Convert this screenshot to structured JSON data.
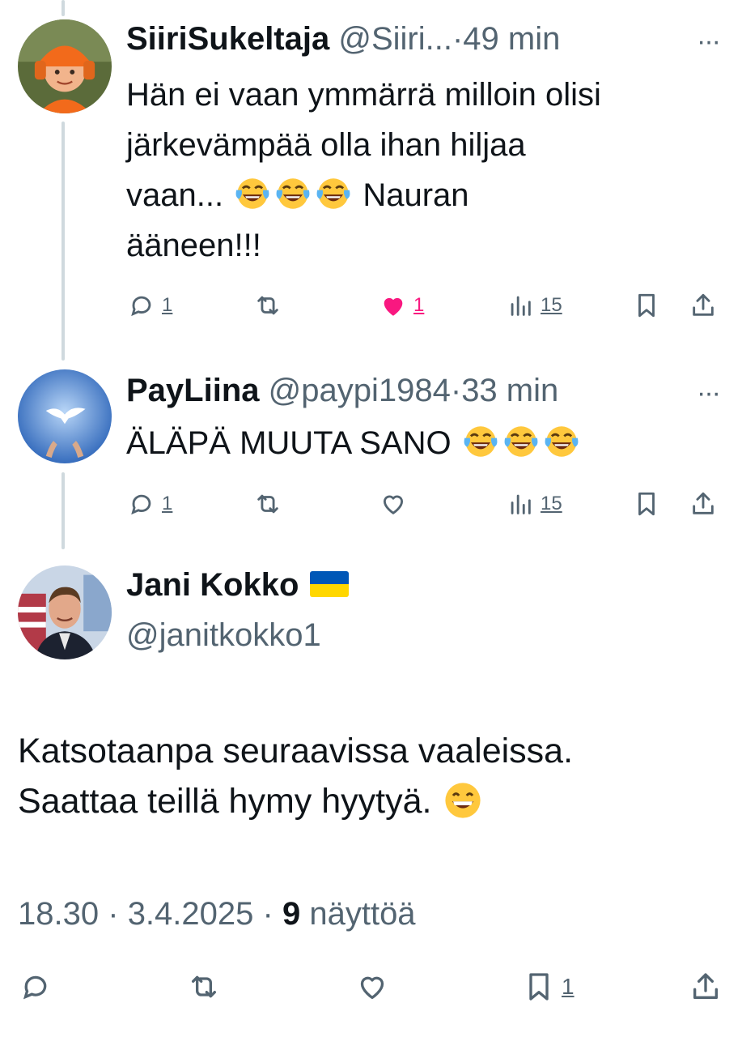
{
  "colors": {
    "text": "#0f1419",
    "secondary": "#536471",
    "like": "#f91880",
    "thread": "#cfd9de"
  },
  "replies": [
    {
      "display_name": "SiiriSukeltaja",
      "handle": "@Siiri...",
      "separator": "·",
      "time": "49 min",
      "more": "···",
      "text_lines": [
        "Hän ei vaan ymmärrä milloin olisi",
        "järkevämpää olla ihan hiljaa",
        "vaan...",
        "Nauran",
        "ääneen!!!"
      ],
      "emoji": "face-with-tears-of-joy",
      "replies_count": "1",
      "likes_count": "1",
      "liked": true,
      "views_count": "15"
    },
    {
      "display_name": "PayLiina",
      "handle": "@paypi1984",
      "separator": "·",
      "time": "33 min",
      "more": "···",
      "text": "ÄLÄPÄ MUUTA SANO",
      "emoji": "face-with-tears-of-joy",
      "replies_count": "1",
      "liked": false,
      "views_count": "15"
    }
  ],
  "main_tweet": {
    "display_name": "Jani Kokko",
    "flag": "ukraine-flag",
    "handle": "@janitkokko1",
    "text_line1": "Katsotaanpa seuraavissa vaaleissa.",
    "text_line2": "Saattaa teillä hymy hyytyä.",
    "emoji": "grinning-face-with-smiling-eyes",
    "time": "18.30",
    "separator": "·",
    "date": "3.4.2025",
    "views_count": "9",
    "views_label": "näyttöä",
    "bookmarks_count": "1"
  }
}
